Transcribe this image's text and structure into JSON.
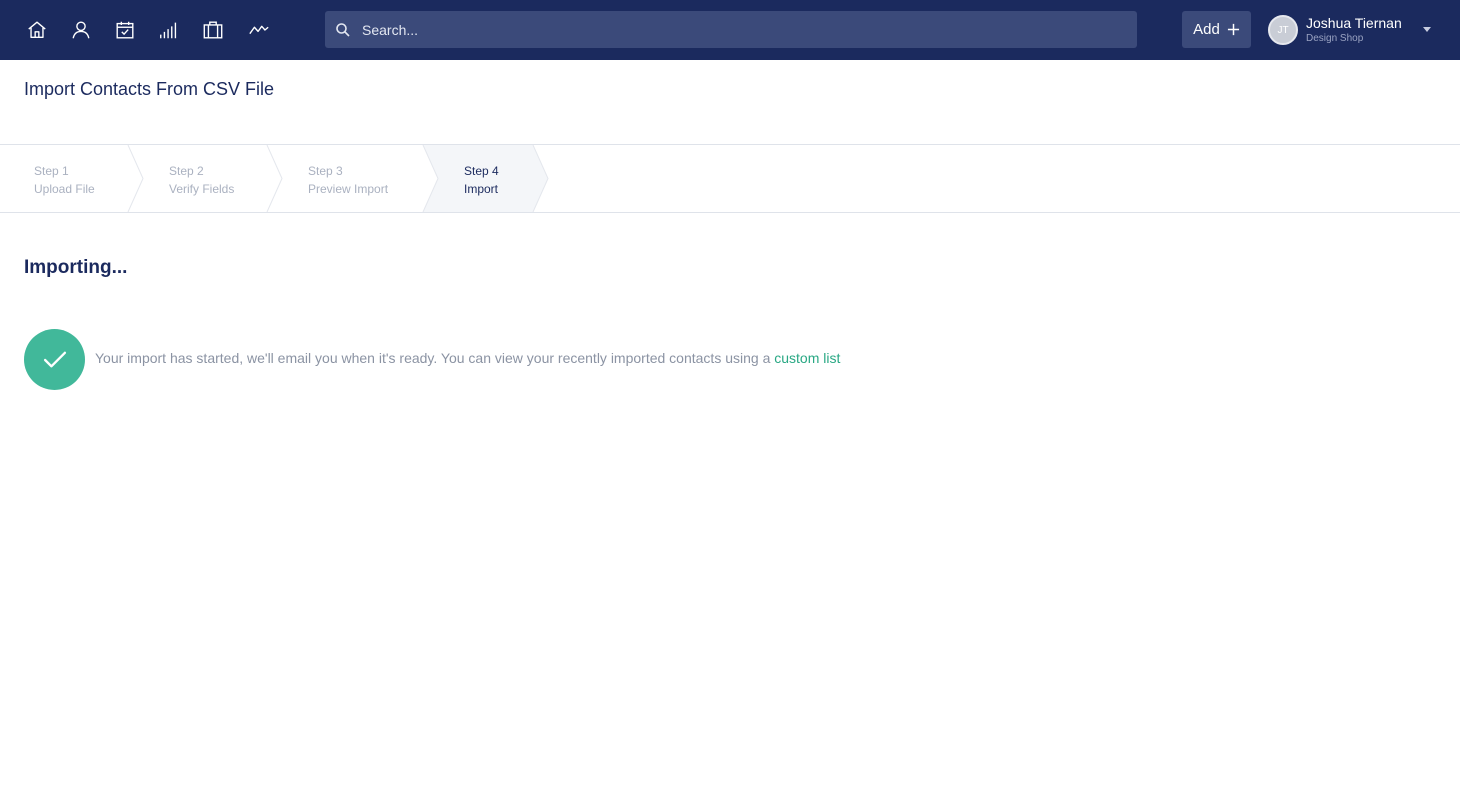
{
  "nav": {
    "icons": [
      "home-icon",
      "contacts-icon",
      "calendar-check-icon",
      "signal-bars-icon",
      "briefcase-icon",
      "activity-icon"
    ]
  },
  "search": {
    "placeholder": "Search..."
  },
  "add_button": {
    "label": "Add"
  },
  "user": {
    "initials": "JT",
    "name": "Joshua Tiernan",
    "company": "Design Shop"
  },
  "page": {
    "title": "Import Contacts From CSV File"
  },
  "steps": [
    {
      "number": "Step 1",
      "label": "Upload File",
      "active": false
    },
    {
      "number": "Step 2",
      "label": "Verify Fields",
      "active": false
    },
    {
      "number": "Step 3",
      "label": "Preview Import",
      "active": false
    },
    {
      "number": "Step 4",
      "label": "Import",
      "active": true
    }
  ],
  "content": {
    "heading": "Importing...",
    "message": "Your import has started, we'll email you when it's ready. You can view your recently imported contacts using a",
    "link_text": "custom list"
  },
  "colors": {
    "nav_background": "#1b2a5e",
    "success": "#41b89a",
    "link": "#29a884",
    "heading_text": "#1b2a5e"
  }
}
